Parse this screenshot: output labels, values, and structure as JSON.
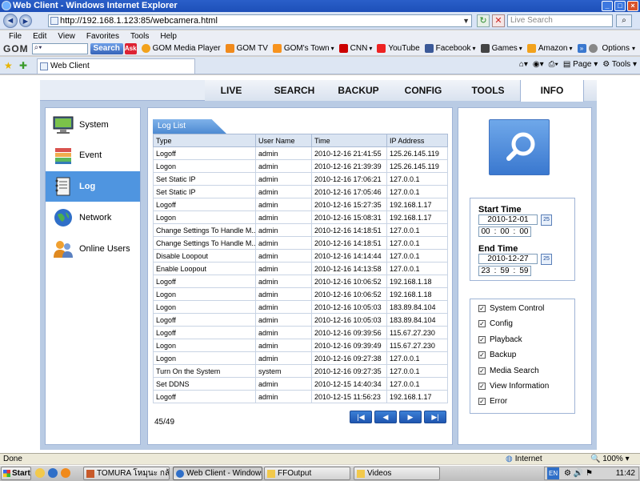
{
  "window": {
    "title": "Web Client - Windows Internet Explorer"
  },
  "addressbar": {
    "url": "http://192.168.1.123:85/webcamera.html",
    "search_placeholder": "Live Search"
  },
  "menubar": [
    "File",
    "Edit",
    "View",
    "Favorites",
    "Tools",
    "Help"
  ],
  "gom_toolbar": {
    "logo": "GOM",
    "search_label": "Search",
    "ask_label": "Ask",
    "items": [
      "GOM Media Player",
      "GOM TV",
      "GOM's Town",
      "CNN",
      "YouTube",
      "Facebook",
      "Games",
      "Amazon"
    ],
    "options_label": "Options"
  },
  "tabbar": {
    "tab_title": "Web Client",
    "page_label": "Page",
    "tools_label": "Tools"
  },
  "nav": {
    "tabs": [
      "LIVE",
      "SEARCH",
      "BACKUP",
      "CONFIG",
      "TOOLS",
      "INFO"
    ],
    "active": "INFO"
  },
  "sidebar": {
    "items": [
      {
        "label": "System"
      },
      {
        "label": "Event"
      },
      {
        "label": "Log"
      },
      {
        "label": "Network"
      },
      {
        "label": "Online Users"
      }
    ]
  },
  "log": {
    "tab_label": "Log List",
    "columns": [
      "Type",
      "User Name",
      "Time",
      "IP Address"
    ],
    "rows": [
      [
        "Logoff",
        "admin",
        "2010-12-16 21:41:55",
        "125.26.145.119"
      ],
      [
        "Logon",
        "admin",
        "2010-12-16 21:39:39",
        "125.26.145.119"
      ],
      [
        "Set Static IP",
        "admin",
        "2010-12-16 17:06:21",
        "127.0.0.1"
      ],
      [
        "Set Static IP",
        "admin",
        "2010-12-16 17:05:46",
        "127.0.0.1"
      ],
      [
        "Logoff",
        "admin",
        "2010-12-16 15:27:35",
        "192.168.1.17"
      ],
      [
        "Logon",
        "admin",
        "2010-12-16 15:08:31",
        "192.168.1.17"
      ],
      [
        "Change Settings To Handle M...",
        "admin",
        "2010-12-16 14:18:51",
        "127.0.0.1"
      ],
      [
        "Change Settings To Handle M...",
        "admin",
        "2010-12-16 14:18:51",
        "127.0.0.1"
      ],
      [
        "Disable Loopout",
        "admin",
        "2010-12-16 14:14:44",
        "127.0.0.1"
      ],
      [
        "Enable Loopout",
        "admin",
        "2010-12-16 14:13:58",
        "127.0.0.1"
      ],
      [
        "Logoff",
        "admin",
        "2010-12-16 10:06:52",
        "192.168.1.18"
      ],
      [
        "Logon",
        "admin",
        "2010-12-16 10:06:52",
        "192.168.1.18"
      ],
      [
        "Logon",
        "admin",
        "2010-12-16 10:05:03",
        "183.89.84.104"
      ],
      [
        "Logoff",
        "admin",
        "2010-12-16 10:05:03",
        "183.89.84.104"
      ],
      [
        "Logoff",
        "admin",
        "2010-12-16 09:39:56",
        "115.67.27.230"
      ],
      [
        "Logon",
        "admin",
        "2010-12-16 09:39:49",
        "115.67.27.230"
      ],
      [
        "Logon",
        "admin",
        "2010-12-16 09:27:38",
        "127.0.0.1"
      ],
      [
        "Turn On the System",
        "system",
        "2010-12-16 09:27:35",
        "127.0.0.1"
      ],
      [
        "Set DDNS",
        "admin",
        "2010-12-15 14:40:34",
        "127.0.0.1"
      ],
      [
        "Logoff",
        "admin",
        "2010-12-15 11:56:23",
        "192.168.1.17"
      ]
    ],
    "page_info": "45/49"
  },
  "search_panel": {
    "start_label": "Start Time",
    "start_date": "2010-12-01",
    "start_time": [
      "00",
      "00",
      "00"
    ],
    "end_label": "End Time",
    "end_date": "2010-12-27",
    "end_time": [
      "23",
      "59",
      "59"
    ],
    "cal_label": "25",
    "filters": [
      "System Control",
      "Config",
      "Playback",
      "Backup",
      "Media Search",
      "View Information",
      "Error"
    ]
  },
  "statusbar": {
    "left": "Done",
    "zone": "Internet",
    "zoom": "100%"
  },
  "taskbar": {
    "start": "Start",
    "tasks": [
      "TOMURA โหมุนะ กล้องวง...",
      "Web Client - Windows...",
      "FFOutput",
      "Videos"
    ],
    "clock": "11:42",
    "lang": "EN"
  },
  "colors": {
    "accent": "#4f95e0",
    "frame": "#b9cbe4",
    "titlebar": "#2a5fc9"
  }
}
